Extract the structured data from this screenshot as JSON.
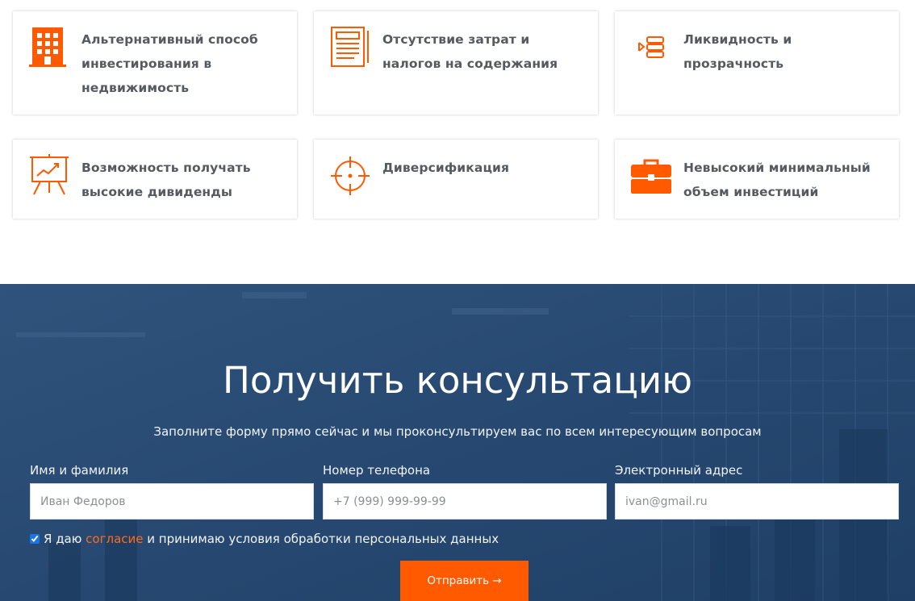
{
  "colors": {
    "accent": "#ff5a00",
    "section_bg": "#2a4c74",
    "card_text": "#555a61"
  },
  "features": [
    {
      "icon": "building-icon",
      "text": "Альтернативный способ инвестирования в недвижимость"
    },
    {
      "icon": "document-icon",
      "text": "Отсутствие затрат и налогов на содержания"
    },
    {
      "icon": "database-stack-icon",
      "text": "Ликвидность и прозрачность"
    },
    {
      "icon": "presentation-chart-icon",
      "text": "Возможность получать высокие дивиденды"
    },
    {
      "icon": "crosshair-icon",
      "text": "Диверсификация"
    },
    {
      "icon": "briefcase-icon",
      "text": "Невысокий минимальный объем инвестиций"
    }
  ],
  "consultation": {
    "title": "Получить консультацию",
    "subtitle": "Заполните форму прямо сейчас и мы проконсультируем вас по всем интересующим вопросам",
    "fields": [
      {
        "label": "Имя и фамилия",
        "placeholder": "Иван Федоров",
        "value": ""
      },
      {
        "label": "Номер телефона",
        "placeholder": "+7 (999) 999-99-99",
        "value": ""
      },
      {
        "label": "Электронный адрес",
        "placeholder": "ivan@gmail.ru",
        "value": ""
      }
    ],
    "consent": {
      "checked": true,
      "prefix": "Я даю",
      "link": "согласие",
      "suffix": "и принимаю условия обработки персональных данных"
    },
    "submit_label": "Отправить →"
  }
}
